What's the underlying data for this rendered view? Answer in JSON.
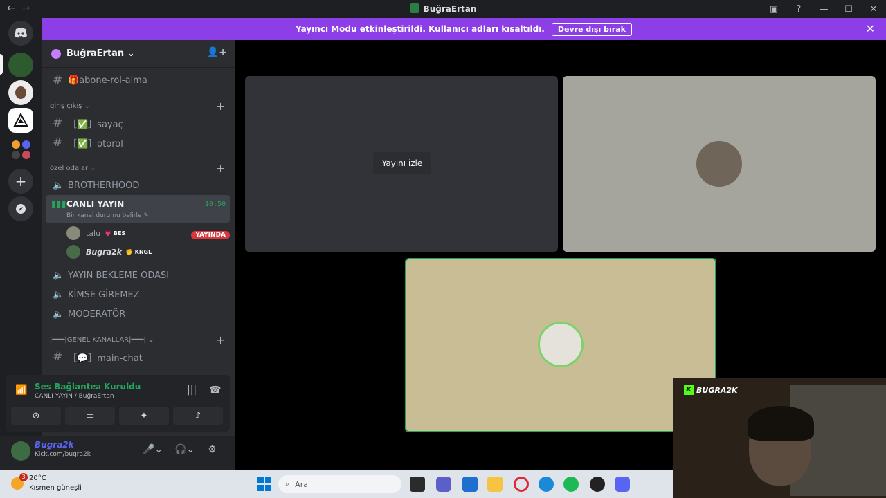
{
  "titlebar": {
    "title": "BuğraErtan",
    "back": "←",
    "forward": "→",
    "icons": [
      "inbox-icon",
      "help-icon",
      "minimize-icon",
      "maximize-icon",
      "close-icon"
    ],
    "glyphs": [
      "▣",
      "?",
      "—",
      "☐",
      "✕"
    ]
  },
  "banner": {
    "text": "Yayıncı Modu etkinleştirildi. Kullanıcı adları kısaltıldı.",
    "button": "Devre dışı bırak",
    "close": "✕"
  },
  "guild": {
    "name": "BuğraErtan ⌄"
  },
  "channels": [
    {
      "name": "🎁abone-rol-alma",
      "type": "text"
    },
    {
      "name": "［✅］sayaç",
      "type": "text"
    },
    {
      "name": "［✅］otorol",
      "type": "text"
    },
    {
      "name": "BROTHERHOOD",
      "type": "voice"
    },
    {
      "name": "YAYIN BEKLEME ODASI",
      "type": "voice"
    },
    {
      "name": "KİMSE GİREMEZ",
      "type": "voice"
    },
    {
      "name": "MODERATÖR",
      "type": "voice"
    },
    {
      "name": "［💬］main-chat",
      "type": "text"
    }
  ],
  "categories": [
    {
      "name": "giriş çıkış ⌄"
    },
    {
      "name": "özel odalar ⌄"
    },
    {
      "name": "|━━━|GENEL KANALLAR|━━━| ⌄"
    }
  ],
  "active_voice": {
    "name": "CANLI YAYIN",
    "status": "Bir kanal durumu belirle ✎",
    "time": "10:50"
  },
  "voice_users": [
    {
      "name": "talu",
      "tag": "💗 BES"
    },
    {
      "name": "𝘽𝙪𝙜𝙧𝙖2𝙠",
      "tag": "✊ KNGL"
    }
  ],
  "live_label": "YAYINDA",
  "voice_panel": {
    "title": "Ses Bağlantısı Kuruldu",
    "location": "CANLI YAYIN / BuğraErtan"
  },
  "user_panel": {
    "name": "𝘽𝙪𝙜𝙧𝙖2𝙠",
    "status": "Kick.com/bugra2k"
  },
  "stage": {
    "watch_button": "Yayını izle"
  },
  "webcam": {
    "brand": "BUGRA2K",
    "logo": "K"
  },
  "taskbar": {
    "weather_temp": "20°C",
    "weather_desc": "Kısmen güneşli",
    "weather_badge": "3",
    "search_placeholder": "Ara"
  },
  "colors": {
    "accent": "#8c3fe6",
    "online": "#23a55a",
    "live": "#da373c",
    "brand": "#5865f2"
  }
}
